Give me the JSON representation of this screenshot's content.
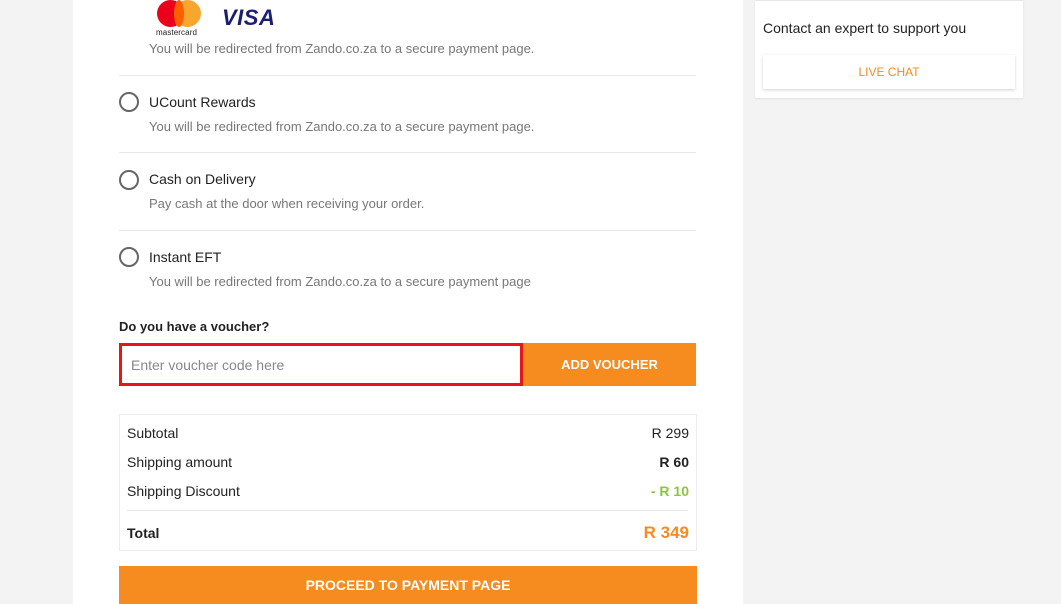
{
  "payment_methods": {
    "card": {
      "mastercard_text": "mastercard",
      "visa_text": "VISA",
      "description": "You will be redirected from Zando.co.za to a secure payment page."
    },
    "items": [
      {
        "title": "UCount Rewards",
        "description": "You will be redirected from Zando.co.za to a secure payment page."
      },
      {
        "title": "Cash on Delivery",
        "description": "Pay cash at the door when receiving your order."
      },
      {
        "title": "Instant EFT",
        "description": "You will be redirected from Zando.co.za to a secure payment page"
      }
    ]
  },
  "voucher": {
    "label": "Do you have a voucher?",
    "placeholder": "Enter voucher code here",
    "button": "ADD VOUCHER"
  },
  "summary": {
    "subtotal_label": "Subtotal",
    "subtotal_value": "R 299",
    "shipping_label": "Shipping amount",
    "shipping_value": "R 60",
    "discount_label": "Shipping Discount",
    "discount_value": "- R 10",
    "total_label": "Total",
    "total_value": "R 349"
  },
  "proceed_button": "PROCEED TO PAYMENT PAGE",
  "sidebar": {
    "contact_text": "Contact an expert to support you",
    "live_chat": "LIVE CHAT"
  },
  "colors": {
    "accent": "#f68b1f",
    "discount": "#8cc63f",
    "input_highlight": "#e8151b"
  }
}
